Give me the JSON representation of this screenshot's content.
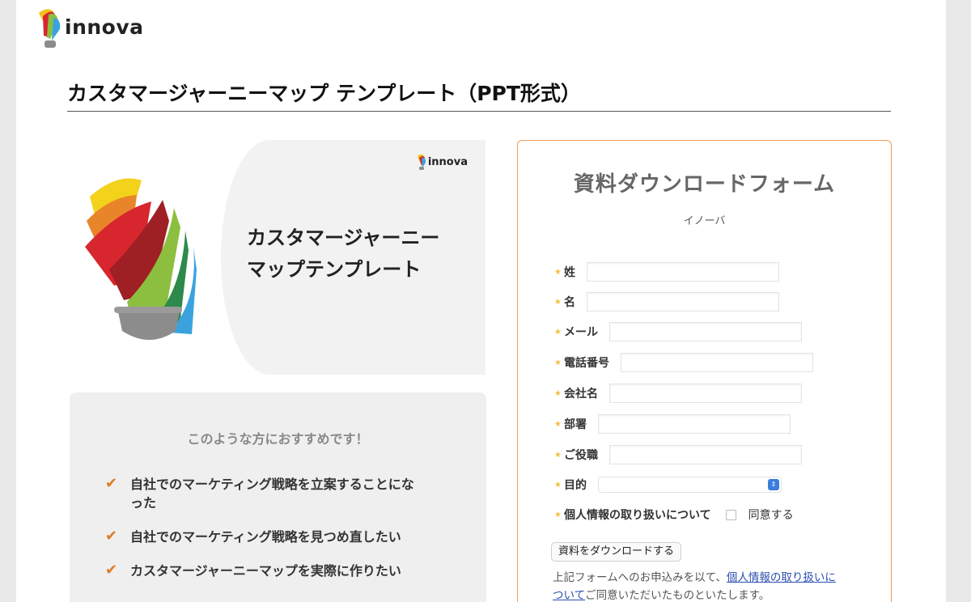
{
  "brand": {
    "name": "innova"
  },
  "page": {
    "title": "カスタマージャーニーマップ テンプレート（PPT形式）"
  },
  "hero": {
    "brand_name": "innova",
    "title_line1": "カスタマージャーニー",
    "title_line2": "マップテンプレート"
  },
  "recommend": {
    "heading": "このような方におすすめです！",
    "items": [
      "自社でのマーケティング戦略を立案することにな\nった",
      "自社でのマーケティング戦略を見つめ直したい",
      "カスタマージャーニーマップを実際に作りたい"
    ]
  },
  "form": {
    "title": "資料ダウンロードフォーム",
    "subtitle": "イノーバ",
    "fields": {
      "last_name": "姓",
      "first_name": "名",
      "email": "メール",
      "phone": "電話番号",
      "company": "会社名",
      "department": "部署",
      "position": "ご役職",
      "purpose": "目的",
      "privacy": "個人情報の取り扱いについて"
    },
    "purpose_selected": "",
    "agree_label": "同意する",
    "agree_checked": false,
    "submit_label": "資料をダウンロードする",
    "notice_prefix": "上記フォームへのお申込みを以て、",
    "notice_link": "個人情報の取り扱いに\nついて",
    "notice_suffix": "ご同意いただいたものといたします。"
  },
  "colors": {
    "accent_orange": "#e07a25",
    "form_border": "#f0a060",
    "required_star": "#f0c040",
    "link": "#2a4fb0"
  },
  "icons": {
    "required": "star-icon",
    "check": "checkmark-icon",
    "select": "chevron-updown-icon"
  }
}
